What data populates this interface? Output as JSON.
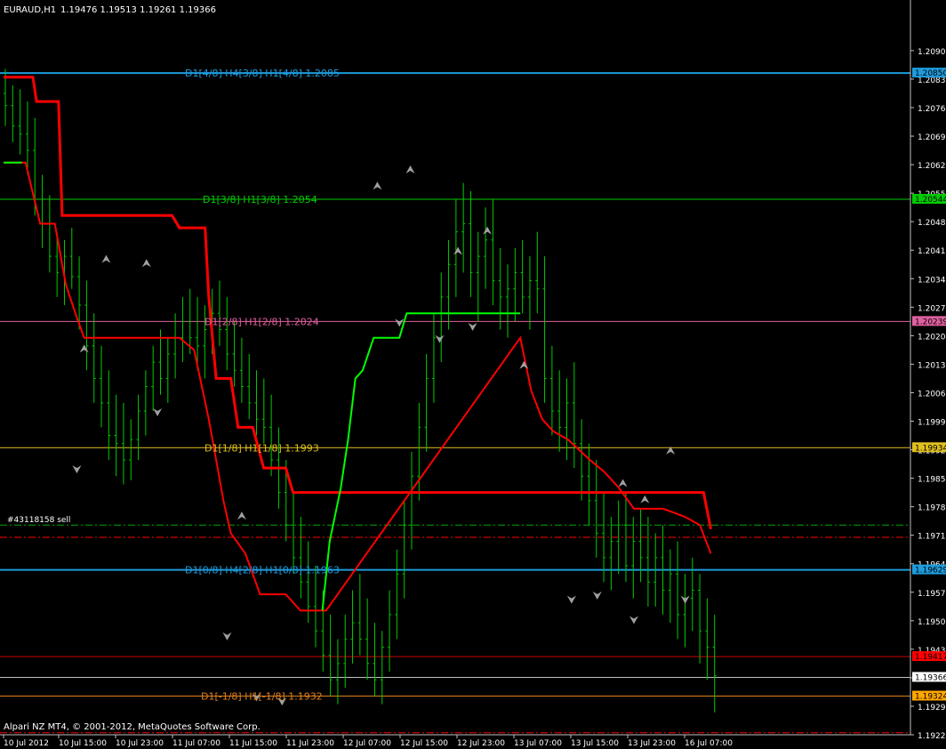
{
  "header": {
    "symbol": "EURAUD,H1",
    "ohlc": "1.19476 1.19513 1.19261 1.19366"
  },
  "footer": {
    "copyright": "Alpari NZ MT4, © 2001-2012, MetaQuotes Software Corp."
  },
  "colors": {
    "background": "#000000",
    "candle": "#00cc00",
    "axis": "#c0c0c0",
    "grid_text": "#ffffff",
    "red_line": "#ff0000",
    "green_line": "#00ff00",
    "arrow": "#a0a0a0"
  },
  "chart_data": {
    "type": "ohlc",
    "ylim": [
      1.19225,
      1.2099
    ],
    "y_ticks": [
      "1.20905",
      "1.20835",
      "1.20765",
      "1.20695",
      "1.20625",
      "1.20555",
      "1.20485",
      "1.20415",
      "1.20345",
      "1.20275",
      "1.20205",
      "1.20135",
      "1.20065",
      "1.19995",
      "1.19925",
      "1.19855",
      "1.19785",
      "1.19715",
      "1.19645",
      "1.19575",
      "1.19505",
      "1.19435",
      "1.19365",
      "1.19295",
      "1.19225"
    ],
    "x_ticks": [
      "10 Jul 2012",
      "10 Jul 15:00",
      "10 Jul 23:00",
      "11 Jul 07:00",
      "11 Jul 15:00",
      "11 Jul 23:00",
      "12 Jul 07:00",
      "12 Jul 15:00",
      "12 Jul 23:00",
      "13 Jul 07:00",
      "13 Jul 15:00",
      "13 Jul 23:00",
      "16 Jul 07:00"
    ],
    "levels": [
      {
        "label": "D1[4/8] H4[3/8] H1[4/8] 1.2085",
        "price": 1.2085,
        "color": "#1e9bdc",
        "tag": "1.20850",
        "tag_color": "#1e9bdc",
        "style": "solid"
      },
      {
        "label": "D1[3/8] H1[3/8] 1.2054",
        "price": 1.2054,
        "color": "#00cc00",
        "tag": "1.20544",
        "tag_color": "#00cc00",
        "style": "solid"
      },
      {
        "label": "D1[2/8] H1[2/8] 1.2024",
        "price": 1.2024,
        "color": "#e060a0",
        "tag": "1.20239",
        "tag_color": "#e060a0",
        "style": "solid"
      },
      {
        "label": "D1[1/8] H1[1/8] 1.1993",
        "price": 1.1993,
        "color": "#e0c020",
        "tag": "1.19934",
        "tag_color": "#e0c020",
        "style": "solid"
      },
      {
        "label": "D1[0/8] H4[2/8] H1[0/8] 1.1963",
        "price": 1.1963,
        "color": "#1e9bdc",
        "tag": "1.19629",
        "tag_color": "#1e9bdc",
        "style": "solid"
      },
      {
        "label": "",
        "price": 1.19417,
        "color": "#cc0000",
        "tag": "1.19417",
        "tag_color": "#ff0000",
        "style": "solid"
      },
      {
        "label": "",
        "price": 1.19366,
        "color": "#c0c0c0",
        "tag": "1.19366",
        "tag_color": "#ffffff",
        "style": "solid"
      },
      {
        "label": "D1[-1/8] H1[-1/8] 1.1932",
        "price": 1.1932,
        "color": "#e08020",
        "tag": "1.19324",
        "tag_color": "#ffa500",
        "style": "solid"
      }
    ],
    "order": {
      "label": "#43118158 sell",
      "price": 1.1974,
      "color": "#00aa00"
    },
    "stop_lines": [
      {
        "price": 1.1971,
        "color": "#ff0000"
      },
      {
        "price": 1.1923,
        "color": "#ff0000"
      }
    ],
    "red_trail": [
      [
        0,
        1.2084
      ],
      [
        8,
        1.2084
      ],
      [
        9,
        1.2078
      ],
      [
        15,
        1.2078
      ],
      [
        16,
        1.205
      ],
      [
        46,
        1.205
      ],
      [
        48,
        1.2047
      ],
      [
        55,
        1.2047
      ],
      [
        56,
        1.203
      ],
      [
        58,
        1.201
      ],
      [
        62,
        1.201
      ],
      [
        64,
        1.1998
      ],
      [
        68,
        1.1998
      ],
      [
        71,
        1.1988
      ],
      [
        77,
        1.1988
      ],
      [
        79,
        1.1982
      ],
      [
        191,
        1.1982
      ],
      [
        193,
        1.1973
      ]
    ],
    "red_trail2": [
      [
        0,
        1.2063
      ],
      [
        6,
        1.2063
      ],
      [
        10,
        1.2048
      ],
      [
        14,
        1.2048
      ],
      [
        17,
        1.2033
      ],
      [
        20,
        1.2025
      ],
      [
        22,
        1.202
      ],
      [
        43,
        1.202
      ],
      [
        48,
        1.202
      ],
      [
        52,
        1.2017
      ],
      [
        56,
        1.2
      ],
      [
        58,
        1.199
      ],
      [
        60,
        1.198
      ],
      [
        62,
        1.1972
      ],
      [
        66,
        1.1967
      ],
      [
        70,
        1.1957
      ],
      [
        77,
        1.1957
      ],
      [
        81,
        1.1953
      ],
      [
        87,
        1.1953
      ],
      [
        88,
        1.1953
      ],
      [
        141,
        1.202
      ],
      [
        144,
        1.2007
      ],
      [
        147,
        1.2
      ],
      [
        150,
        1.1997
      ],
      [
        154,
        1.1995
      ],
      [
        160,
        1.199
      ],
      [
        164,
        1.1987
      ],
      [
        168,
        1.1983
      ],
      [
        172,
        1.1978
      ],
      [
        180,
        1.1978
      ],
      [
        186,
        1.1976
      ],
      [
        190,
        1.1974
      ],
      [
        193,
        1.1967
      ]
    ],
    "green_trail": [
      [
        0,
        1.2063
      ],
      [
        5,
        1.2063
      ]
    ],
    "green_trail2": [
      [
        87,
        1.1953
      ],
      [
        89,
        1.197
      ],
      [
        92,
        1.1983
      ],
      [
        94,
        1.1995
      ],
      [
        96,
        1.201
      ],
      [
        98,
        1.2012
      ],
      [
        101,
        1.202
      ],
      [
        108,
        1.202
      ],
      [
        110,
        1.2026
      ],
      [
        141,
        1.2026
      ]
    ],
    "up_arrows": [
      [
        28,
        1.2039
      ],
      [
        39,
        1.2038
      ],
      [
        22,
        1.2017
      ],
      [
        102,
        1.2057
      ],
      [
        111,
        1.2061
      ],
      [
        124,
        1.2041
      ],
      [
        132,
        1.2046
      ],
      [
        142,
        1.2013
      ],
      [
        169,
        1.1984
      ],
      [
        175,
        1.198
      ],
      [
        182,
        1.1992
      ],
      [
        65,
        1.1976
      ]
    ],
    "down_arrows": [
      [
        20,
        1.1988
      ],
      [
        42,
        1.2002
      ],
      [
        61,
        1.1947
      ],
      [
        108,
        1.2024
      ],
      [
        119,
        1.202
      ],
      [
        128,
        1.2023
      ],
      [
        155,
        1.1956
      ],
      [
        162,
        1.1957
      ],
      [
        172,
        1.1951
      ],
      [
        186,
        1.1956
      ],
      [
        69,
        1.1932
      ],
      [
        76,
        1.1931
      ]
    ],
    "candles": [
      [
        1.208,
        1.2086,
        1.2072,
        1.2077
      ],
      [
        1.2077,
        1.2082,
        1.2068,
        1.2072
      ],
      [
        1.2072,
        1.2081,
        1.2065,
        1.207
      ],
      [
        1.207,
        1.2078,
        1.206,
        1.2066
      ],
      [
        1.2066,
        1.2074,
        1.205,
        1.2054
      ],
      [
        1.2054,
        1.206,
        1.2042,
        1.2048
      ],
      [
        1.2048,
        1.2055,
        1.2036,
        1.204
      ],
      [
        1.204,
        1.2046,
        1.203,
        1.2036
      ],
      [
        1.2036,
        1.2044,
        1.2028,
        1.204
      ],
      [
        1.204,
        1.2047,
        1.2032,
        1.2035
      ],
      [
        1.2035,
        1.204,
        1.2022,
        1.2028
      ],
      [
        1.2028,
        1.2034,
        1.2012,
        1.2018
      ],
      [
        1.2018,
        1.2026,
        1.2004,
        1.201
      ],
      [
        1.201,
        1.2018,
        1.1998,
        1.2004
      ],
      [
        1.2004,
        1.2012,
        1.199,
        1.1996
      ],
      [
        1.1996,
        1.2006,
        1.1986,
        1.1994
      ],
      [
        1.1994,
        1.2004,
        1.1984,
        1.199
      ],
      [
        1.199,
        1.2,
        1.1985,
        1.1995
      ],
      [
        1.1995,
        1.2006,
        1.199,
        1.2002
      ],
      [
        1.2002,
        1.2012,
        1.1996,
        1.2008
      ],
      [
        1.2008,
        1.2018,
        1.2002,
        1.2014
      ],
      [
        1.2014,
        1.2022,
        1.2006,
        1.201
      ],
      [
        1.201,
        1.202,
        1.2004,
        1.2016
      ],
      [
        1.2016,
        1.2026,
        1.201,
        1.202
      ],
      [
        1.202,
        1.203,
        1.2014,
        1.2024
      ],
      [
        1.2024,
        1.2032,
        1.2016,
        1.202
      ],
      [
        1.202,
        1.203,
        1.2012,
        1.2018
      ],
      [
        1.2018,
        1.2028,
        1.201,
        1.2022
      ],
      [
        1.2022,
        1.2032,
        1.2016,
        1.2026
      ],
      [
        1.2026,
        1.2034,
        1.2018,
        1.2022
      ],
      [
        1.2022,
        1.203,
        1.2012,
        1.2016
      ],
      [
        1.2016,
        1.2024,
        1.2008,
        1.2012
      ],
      [
        1.2012,
        1.202,
        1.2004,
        1.2008
      ],
      [
        1.2008,
        1.2016,
        1.2,
        1.2004
      ],
      [
        1.2004,
        1.2012,
        1.1996,
        1.2
      ],
      [
        1.2,
        1.201,
        1.1994,
        1.1998
      ],
      [
        1.1998,
        1.2006,
        1.1986,
        1.199
      ],
      [
        1.199,
        1.1998,
        1.1978,
        1.1982
      ],
      [
        1.1982,
        1.199,
        1.197,
        1.1974
      ],
      [
        1.1974,
        1.1982,
        1.1962,
        1.1966
      ],
      [
        1.1966,
        1.1976,
        1.1956,
        1.196
      ],
      [
        1.196,
        1.197,
        1.195,
        1.1954
      ],
      [
        1.1954,
        1.1964,
        1.1944,
        1.1948
      ],
      [
        1.1948,
        1.1958,
        1.1938,
        1.1942
      ],
      [
        1.1942,
        1.1952,
        1.1932,
        1.1936
      ],
      [
        1.1936,
        1.1946,
        1.193,
        1.194
      ],
      [
        1.194,
        1.1952,
        1.1934,
        1.1946
      ],
      [
        1.1946,
        1.1958,
        1.194,
        1.195
      ],
      [
        1.195,
        1.1962,
        1.1942,
        1.1946
      ],
      [
        1.1946,
        1.1956,
        1.1936,
        1.194
      ],
      [
        1.194,
        1.195,
        1.1932,
        1.1936
      ],
      [
        1.1936,
        1.1948,
        1.193,
        1.1944
      ],
      [
        1.1944,
        1.1958,
        1.1938,
        1.1952
      ],
      [
        1.1952,
        1.1968,
        1.1946,
        1.1962
      ],
      [
        1.1962,
        1.198,
        1.1956,
        1.1974
      ],
      [
        1.1974,
        1.1992,
        1.1968,
        1.1986
      ],
      [
        1.1986,
        1.2004,
        1.198,
        1.1998
      ],
      [
        1.1998,
        1.2016,
        1.1992,
        1.201
      ],
      [
        1.201,
        1.2026,
        1.2004,
        1.202
      ],
      [
        1.202,
        1.2036,
        1.2014,
        1.203
      ],
      [
        1.203,
        1.2044,
        1.2022,
        1.2038
      ],
      [
        1.2038,
        1.2054,
        1.203,
        1.2046
      ],
      [
        1.2046,
        1.2058,
        1.2036,
        1.2048
      ],
      [
        1.2048,
        1.2056,
        1.203,
        1.2036
      ],
      [
        1.2036,
        1.2046,
        1.2024,
        1.204
      ],
      [
        1.204,
        1.2052,
        1.2032,
        1.2044
      ],
      [
        1.2044,
        1.2054,
        1.2028,
        1.2034
      ],
      [
        1.2034,
        1.2042,
        1.2022,
        1.203
      ],
      [
        1.203,
        1.2038,
        1.202,
        1.2032
      ],
      [
        1.2032,
        1.2042,
        1.2024,
        1.2036
      ],
      [
        1.2036,
        1.2044,
        1.2026,
        1.203
      ],
      [
        1.203,
        1.204,
        1.2022,
        1.2034
      ],
      [
        1.2034,
        1.2046,
        1.2026,
        1.2032
      ],
      [
        1.2032,
        1.204,
        1.2004,
        1.201
      ],
      [
        1.201,
        1.2018,
        1.1996,
        1.2002
      ],
      [
        1.2002,
        1.2012,
        1.1992,
        1.1998
      ],
      [
        1.1998,
        1.201,
        1.199,
        1.2004
      ],
      [
        1.2004,
        1.2014,
        1.1988,
        1.1994
      ],
      [
        1.1994,
        1.2,
        1.198,
        1.1986
      ],
      [
        1.1986,
        1.1994,
        1.1974,
        1.198
      ],
      [
        1.198,
        1.199,
        1.1966,
        1.1972
      ],
      [
        1.1972,
        1.1982,
        1.196,
        1.1966
      ],
      [
        1.1966,
        1.1976,
        1.1958,
        1.197
      ],
      [
        1.197,
        1.198,
        1.1962,
        1.1974
      ],
      [
        1.1974,
        1.1982,
        1.196,
        1.1964
      ],
      [
        1.1964,
        1.1976,
        1.1956,
        1.197
      ],
      [
        1.197,
        1.1978,
        1.196,
        1.1966
      ],
      [
        1.1966,
        1.1976,
        1.1954,
        1.196
      ],
      [
        1.196,
        1.1972,
        1.1954,
        1.1966
      ],
      [
        1.1966,
        1.1974,
        1.1952,
        1.1958
      ],
      [
        1.1958,
        1.1968,
        1.195,
        1.1962
      ],
      [
        1.1962,
        1.197,
        1.1946,
        1.1952
      ],
      [
        1.1952,
        1.1962,
        1.1944,
        1.1956
      ],
      [
        1.1956,
        1.1966,
        1.1948,
        1.1958
      ],
      [
        1.1958,
        1.1962,
        1.194,
        1.1948
      ],
      [
        1.1948,
        1.1956,
        1.1936,
        1.1944
      ],
      [
        1.1944,
        1.1952,
        1.1928,
        1.1937
      ]
    ]
  }
}
